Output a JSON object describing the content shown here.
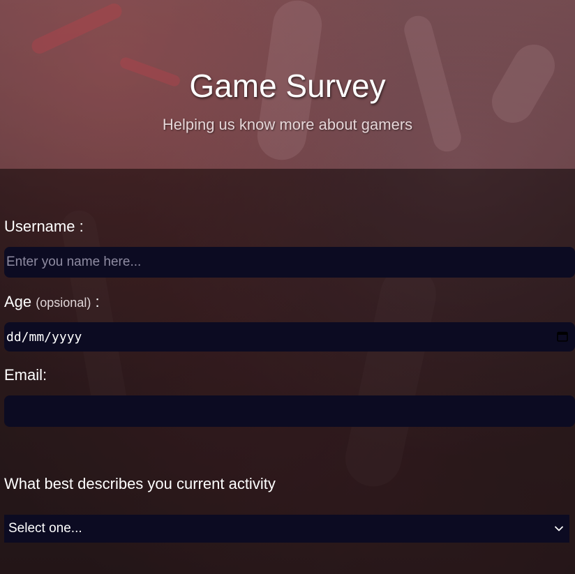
{
  "header": {
    "title": "Game Survey",
    "subtitle": "Helping us know more about gamers"
  },
  "form": {
    "username": {
      "label": "Username :",
      "placeholder": "Enter you name here..."
    },
    "age": {
      "label": "Age",
      "note": "(opsional)",
      "suffix": " :",
      "value": "dd/mm/yyyy"
    },
    "email": {
      "label": "Email:",
      "value": ""
    },
    "activity": {
      "label": "What best describes you current activity",
      "selected": "Select one..."
    }
  },
  "colors": {
    "field_bg": "#0c0b22",
    "text": "#ffffff",
    "placeholder": "#8f8ca2"
  },
  "icons": {
    "date": "calendar-icon",
    "select": "chevron-down-icon"
  }
}
